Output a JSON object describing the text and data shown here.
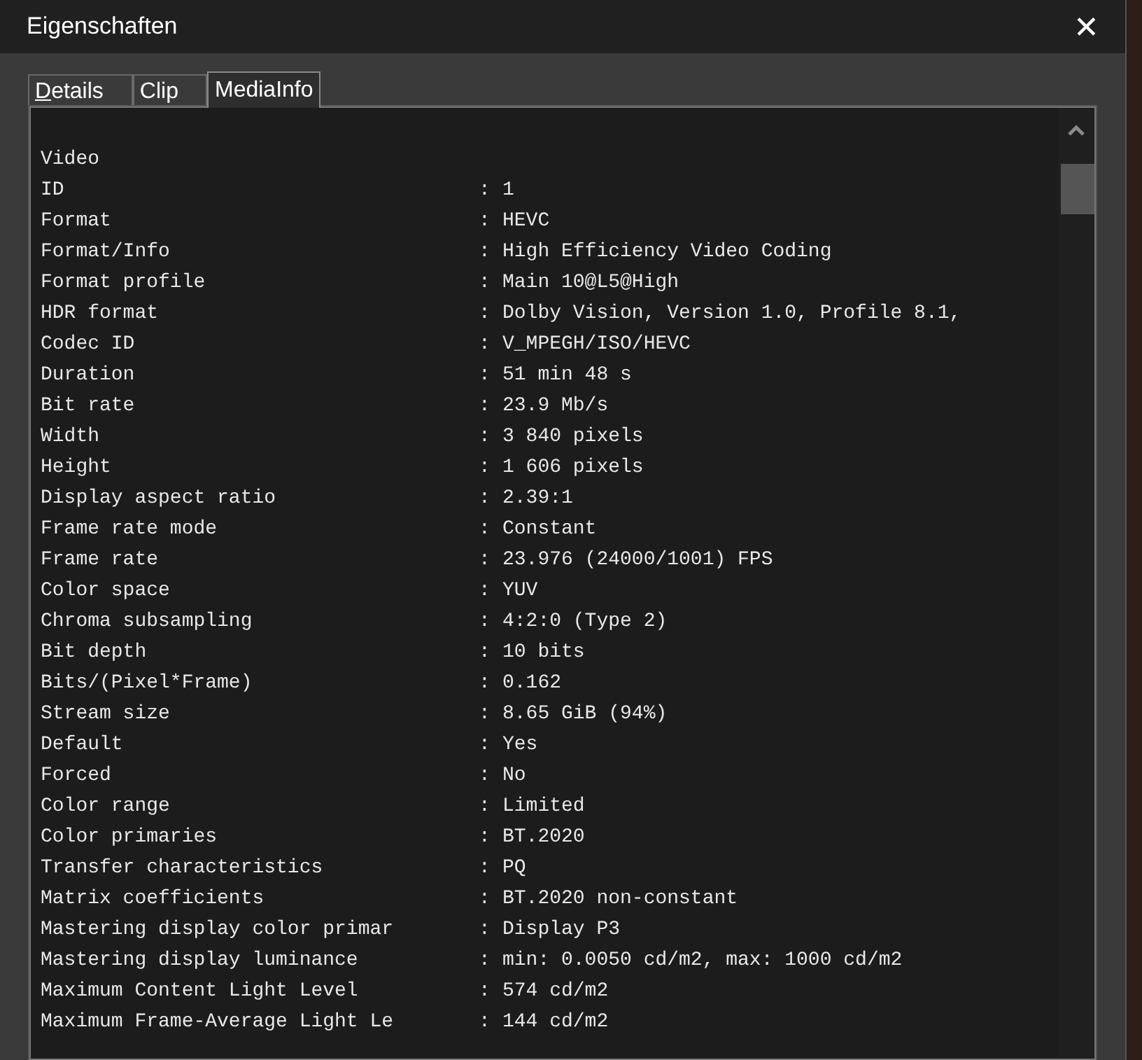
{
  "window": {
    "title": "Eigenschaften",
    "close": "✕"
  },
  "tabs": [
    {
      "label": "Details",
      "selected": false
    },
    {
      "label": "Clip",
      "selected": false
    },
    {
      "label": "MediaInfo",
      "selected": true
    }
  ],
  "mediainfo": {
    "section": "Video",
    "rows": [
      {
        "label": "ID",
        "sep": ":",
        "value": "1"
      },
      {
        "label": "Format",
        "sep": ":",
        "value": "HEVC"
      },
      {
        "label": "Format/Info",
        "sep": ":",
        "value": "High Efficiency Video Coding"
      },
      {
        "label": "Format profile",
        "sep": ":",
        "value": "Main 10@L5@High"
      },
      {
        "label": "HDR format",
        "sep": ":",
        "value": "Dolby Vision, Version 1.0, Profile 8.1,"
      },
      {
        "label": "Codec ID",
        "sep": ":",
        "value": "V_MPEGH/ISO/HEVC"
      },
      {
        "label": "Duration",
        "sep": ":",
        "value": "51 min 48 s"
      },
      {
        "label": "Bit rate",
        "sep": ":",
        "value": "23.9 Mb/s"
      },
      {
        "label": "Width",
        "sep": ":",
        "value": "3 840 pixels"
      },
      {
        "label": "Height",
        "sep": ":",
        "value": "1 606 pixels"
      },
      {
        "label": "Display aspect ratio",
        "sep": ":",
        "value": "2.39:1"
      },
      {
        "label": "Frame rate mode",
        "sep": ":",
        "value": "Constant"
      },
      {
        "label": "Frame rate",
        "sep": ":",
        "value": "23.976 (24000/1001) FPS"
      },
      {
        "label": "Color space",
        "sep": ":",
        "value": "YUV"
      },
      {
        "label": "Chroma subsampling",
        "sep": ":",
        "value": "4:2:0 (Type 2)"
      },
      {
        "label": "Bit depth",
        "sep": ":",
        "value": "10 bits"
      },
      {
        "label": "Bits/(Pixel*Frame)",
        "sep": ":",
        "value": "0.162"
      },
      {
        "label": "Stream size",
        "sep": ":",
        "value": "8.65 GiB (94%)"
      },
      {
        "label": "Default",
        "sep": ":",
        "value": "Yes"
      },
      {
        "label": "Forced",
        "sep": ":",
        "value": "No"
      },
      {
        "label": "Color range",
        "sep": ":",
        "value": "Limited"
      },
      {
        "label": "Color primaries",
        "sep": ":",
        "value": "BT.2020"
      },
      {
        "label": "Transfer characteristics",
        "sep": ":",
        "value": "PQ"
      },
      {
        "label": "Matrix coefficients",
        "sep": ":",
        "value": "BT.2020 non-constant"
      },
      {
        "label": "Mastering display color primar",
        "sep": ":",
        "value": "Display P3"
      },
      {
        "label": "Mastering display luminance",
        "sep": ":",
        "value": "min: 0.0050 cd/m2, max: 1000 cd/m2"
      },
      {
        "label": "Maximum Content Light Level",
        "sep": ":",
        "value": "574 cd/m2"
      },
      {
        "label": "Maximum Frame-Average Light Le",
        "sep": ":",
        "value": "144 cd/m2"
      }
    ]
  }
}
